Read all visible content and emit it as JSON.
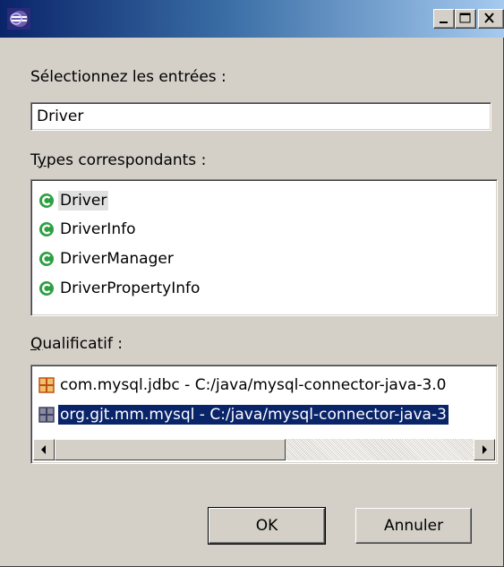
{
  "window": {
    "title": "",
    "controls": {
      "minimize_icon": "minimize-icon",
      "maximize_icon": "maximize-icon",
      "close_icon": "close-icon"
    }
  },
  "search": {
    "label": "Sélectionnez les entrées :",
    "value": "Driver"
  },
  "types": {
    "label_prefix": "T",
    "label_mnemonic": "y",
    "label_rest": "pes correspondants :",
    "items": [
      {
        "label": "Driver",
        "icon": "class-icon",
        "selected": true
      },
      {
        "label": "DriverInfo",
        "icon": "class-icon",
        "selected": false
      },
      {
        "label": "DriverManager",
        "icon": "class-icon",
        "selected": false
      },
      {
        "label": "DriverPropertyInfo",
        "icon": "class-icon",
        "selected": false
      }
    ]
  },
  "qualifier": {
    "label_mnemonic": "Q",
    "label_rest": "ualificatif :",
    "items": [
      {
        "label": "com.mysql.jdbc - C:/java/mysql-connector-java-3.0",
        "icon": "package-icon",
        "selected": false
      },
      {
        "label": "org.gjt.mm.mysql - C:/java/mysql-connector-java-3",
        "icon": "package-icon",
        "selected": true
      }
    ],
    "scroll_position": 0
  },
  "buttons": {
    "ok": "OK",
    "cancel": "Annuler"
  },
  "colors": {
    "title_start": "#0a246a",
    "title_end": "#a6caf0",
    "face": "#d4d0c8",
    "selection": "#0a246a",
    "class_icon": "#2ea043"
  }
}
